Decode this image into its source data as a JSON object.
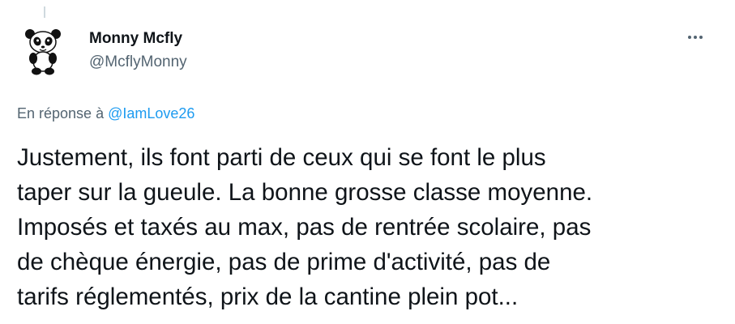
{
  "tweet": {
    "author": {
      "display_name": "Monny Mcfly",
      "handle": "@McflyMonny",
      "avatar_icon": "panda-avatar-icon"
    },
    "more_icon": "more-horizontal-icon",
    "reply_context": {
      "prefix": "En réponse à",
      "mention": "@IamLove26"
    },
    "text_lines": [
      "Justement, ils font parti de ceux qui se font le plus",
      "taper sur la gueule. La bonne grosse classe moyenne.",
      "Imposés et taxés au max, pas de rentrée scolaire, pas",
      "de chèque énergie, pas de prime d'activité, pas de",
      "tarifs réglementés, prix de la cantine plein pot..."
    ]
  },
  "colors": {
    "text_primary": "#0f1419",
    "text_secondary": "#536471",
    "link": "#1d9bf0",
    "thread_line": "#cfd9de"
  }
}
